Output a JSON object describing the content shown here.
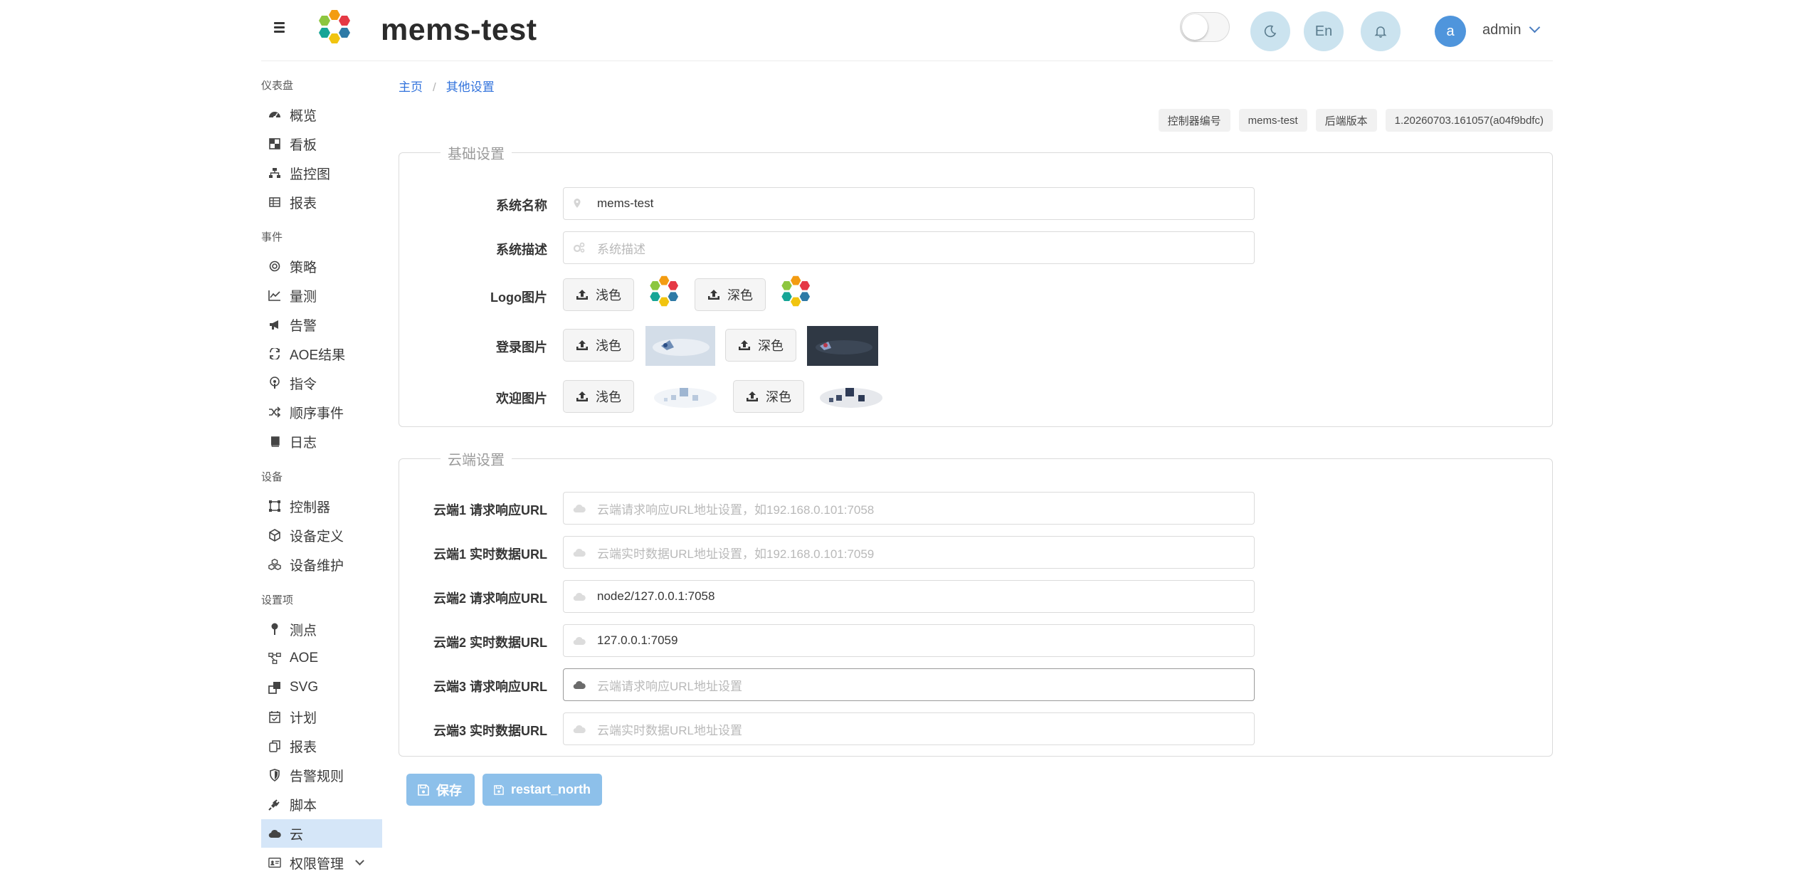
{
  "header": {
    "app_title": "mems-test",
    "lang_button": "En",
    "user_initial": "a",
    "username": "admin"
  },
  "sidebar": {
    "sections": [
      {
        "label": "仪表盘",
        "items": [
          {
            "label": "概览",
            "icon": "dashboard-icon"
          },
          {
            "label": "看板",
            "icon": "board-icon"
          },
          {
            "label": "监控图",
            "icon": "sitemap-icon"
          },
          {
            "label": "报表",
            "icon": "table-icon"
          }
        ]
      },
      {
        "label": "事件",
        "items": [
          {
            "label": "策略",
            "icon": "target-icon"
          },
          {
            "label": "量测",
            "icon": "chart-line-icon"
          },
          {
            "label": "告警",
            "icon": "bullhorn-icon"
          },
          {
            "label": "AOE结果",
            "icon": "exchange-icon"
          },
          {
            "label": "指令",
            "icon": "podcast-icon"
          },
          {
            "label": "顺序事件",
            "icon": "random-icon"
          },
          {
            "label": "日志",
            "icon": "book-icon"
          }
        ]
      },
      {
        "label": "设备",
        "items": [
          {
            "label": "控制器",
            "icon": "vector-square-icon"
          },
          {
            "label": "设备定义",
            "icon": "cube-icon"
          },
          {
            "label": "设备维护",
            "icon": "cubes-icon"
          }
        ]
      },
      {
        "label": "设置项",
        "items": [
          {
            "label": "测点",
            "icon": "map-pin-icon"
          },
          {
            "label": "AOE",
            "icon": "project-diagram-icon"
          },
          {
            "label": "SVG",
            "icon": "clone-icon"
          },
          {
            "label": "计划",
            "icon": "calendar-check-icon"
          },
          {
            "label": "报表",
            "icon": "copy-icon"
          },
          {
            "label": "告警规则",
            "icon": "shield-icon"
          },
          {
            "label": "脚本",
            "icon": "plug-icon"
          },
          {
            "label": "云",
            "icon": "cloud-icon",
            "active": true
          },
          {
            "label": "权限管理",
            "icon": "id-card-icon",
            "expandable": true
          }
        ]
      }
    ]
  },
  "breadcrumb": {
    "home": "主页",
    "current": "其他设置"
  },
  "info_tags": {
    "controller_label": "控制器编号",
    "controller_value": "mems-test",
    "backend_label": "后端版本",
    "backend_value": "1.20260703.161057(a04f9bdfc)"
  },
  "basic": {
    "legend": "基础设置",
    "system_name": {
      "label": "系统名称",
      "value": "mems-test"
    },
    "system_desc": {
      "label": "系统描述",
      "placeholder": "系统描述"
    },
    "logo": {
      "label": "Logo图片"
    },
    "login": {
      "label": "登录图片"
    },
    "welcome": {
      "label": "欢迎图片"
    },
    "light_label": "浅色",
    "dark_label": "深色"
  },
  "cloud": {
    "legend": "云端设置",
    "fields": [
      {
        "label": "云端1 请求响应URL",
        "value": "",
        "placeholder": "云端请求响应URL地址设置，如192.168.0.101:7058"
      },
      {
        "label": "云端1 实时数据URL",
        "value": "",
        "placeholder": "云端实时数据URL地址设置，如192.168.0.101:7059"
      },
      {
        "label": "云端2 请求响应URL",
        "value": "node2/127.0.0.1:7058",
        "placeholder": ""
      },
      {
        "label": "云端2 实时数据URL",
        "value": "127.0.0.1:7059",
        "placeholder": ""
      },
      {
        "label": "云端3 请求响应URL",
        "value": "",
        "placeholder": "云端请求响应URL地址设置",
        "focused": true
      },
      {
        "label": "云端3 实时数据URL",
        "value": "",
        "placeholder": "云端实时数据URL地址设置"
      }
    ]
  },
  "actions": {
    "save": "保存",
    "restart": "restart_north"
  },
  "colors": {
    "accent": "#3273dc",
    "button": "#8dc0ea",
    "active_menu": "#d5e6f8"
  }
}
